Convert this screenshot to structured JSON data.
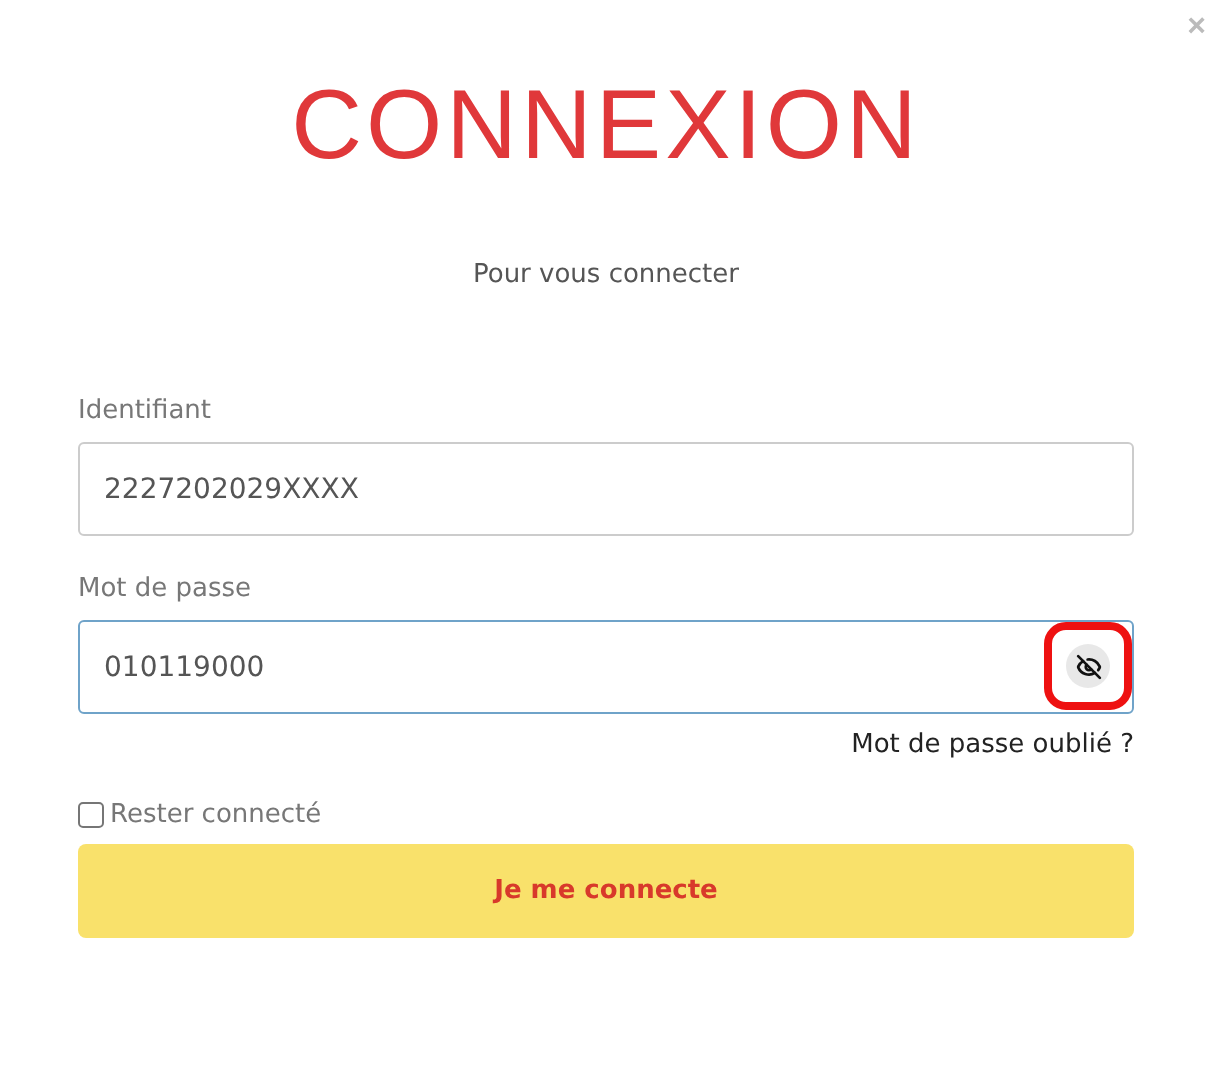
{
  "close": "×",
  "title": "CONNEXION",
  "subtitle": "Pour vous connecter",
  "fields": [
    {
      "label": "Identifiant",
      "value": "2227202029XXXX",
      "kind": "text",
      "focused": false
    },
    {
      "label": "Mot de passe",
      "value": "010119000",
      "kind": "password",
      "focused": true,
      "revealed": true,
      "toggle_highlighted": true
    }
  ],
  "forgot_link": "Mot de passe oublié ?",
  "remember": {
    "label": "Rester connecté",
    "checked": false
  },
  "submit": "Je me connecte"
}
